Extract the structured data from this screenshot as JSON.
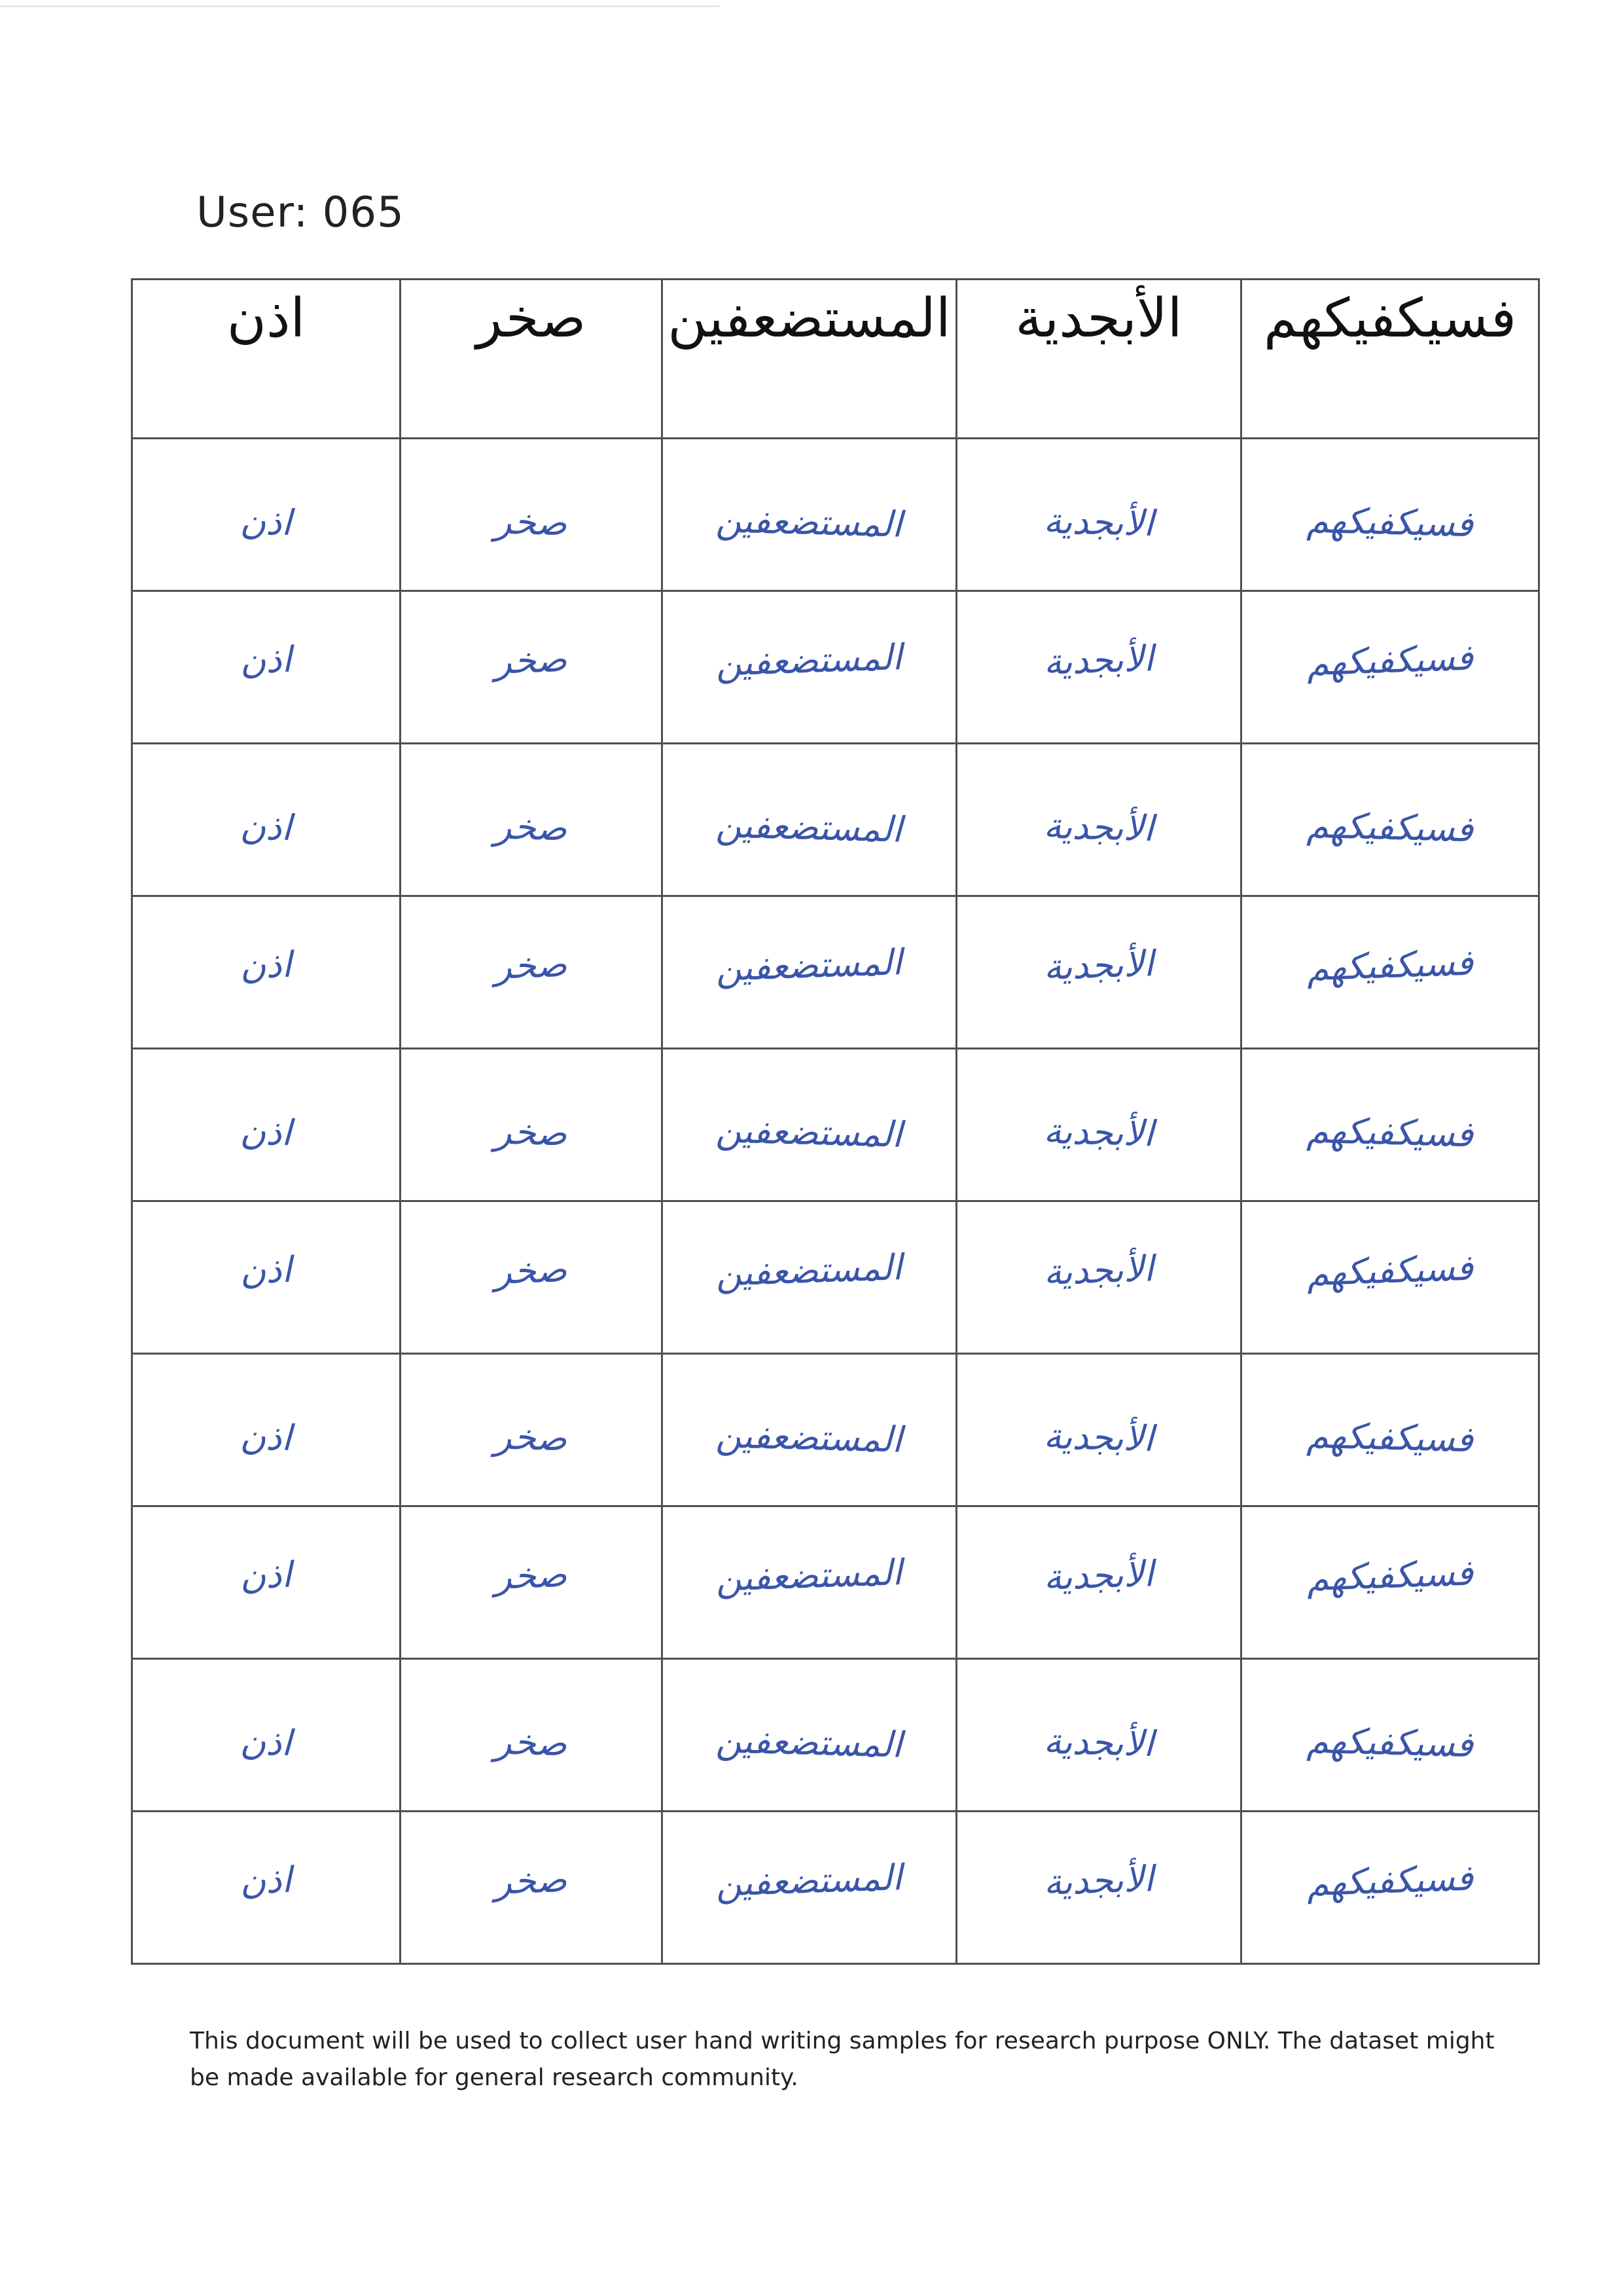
{
  "header": {
    "user_label": "User: 065"
  },
  "columns": [
    "فسيكفيكهم",
    "الأبجدية",
    "المستضعفين",
    "صخر",
    "اذن"
  ],
  "rows": [
    [
      "فسيكفيكهم",
      "الأبجدية",
      "المستضعفين",
      "صخر",
      "اذن"
    ],
    [
      "فسيكفيكهم",
      "الأبجدية",
      "المستضعفين",
      "صخر",
      "اذن"
    ],
    [
      "فسيكفيكهم",
      "الأبجدية",
      "المستضعفين",
      "صخر",
      "اذن"
    ],
    [
      "فسيكفيكهم",
      "الأبجدية",
      "المستضعفين",
      "صخر",
      "اذن"
    ],
    [
      "فسيكفيكهم",
      "الأبجدية",
      "المستضعفين",
      "صخر",
      "اذن"
    ],
    [
      "فسيكفيكهم",
      "الأبجدية",
      "المستضعفين",
      "صخر",
      "اذن"
    ],
    [
      "فسيكفيكهم",
      "الأبجدية",
      "المستضعفين",
      "صخر",
      "اذن"
    ],
    [
      "فسيكفيكهم",
      "الأبجدية",
      "المستضعفين",
      "صخر",
      "اذن"
    ],
    [
      "فسيكفيكهم",
      "الأبجدية",
      "المستضعفين",
      "صخر",
      "اذن"
    ],
    [
      "فسيكفيكهم",
      "الأبجدية",
      "المستضعفين",
      "صخر",
      "اذن"
    ]
  ],
  "footer": {
    "disclaimer": "This document will be used to collect user hand writing samples for research purpose ONLY. The dataset might be made available for general research community."
  },
  "colors": {
    "ink": "#3a55a8",
    "grid": "#505050",
    "text": "#222222"
  }
}
